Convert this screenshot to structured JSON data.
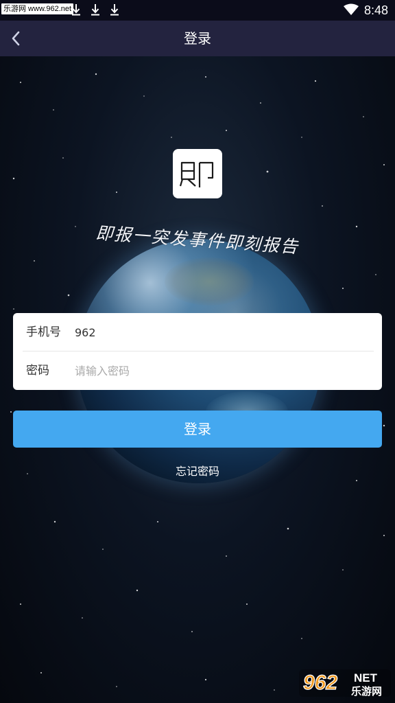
{
  "status_bar": {
    "badge": "乐游网 www.962.net",
    "time": "8:48",
    "icons": [
      "download-icon",
      "download-icon",
      "download-icon",
      "download-icon",
      "wifi-icon",
      "battery-icon"
    ]
  },
  "header": {
    "title": "登录",
    "back_icon": "back-arrow-icon"
  },
  "logo": {
    "glyph": "即"
  },
  "slogan": "即报一突发事件即刻报告",
  "form": {
    "phone_label": "手机号",
    "phone_value": "962",
    "password_label": "密码",
    "password_placeholder": "请输入密码"
  },
  "login_button": "登录",
  "forgot_password": "忘记密码",
  "watermark": {
    "number": "962",
    "suffix": "NET",
    "text": "乐游网"
  },
  "colors": {
    "status_bar": "#0b0c1a",
    "header": "#23233f",
    "button": "#44a8f0",
    "text_light": "#ffffff"
  }
}
